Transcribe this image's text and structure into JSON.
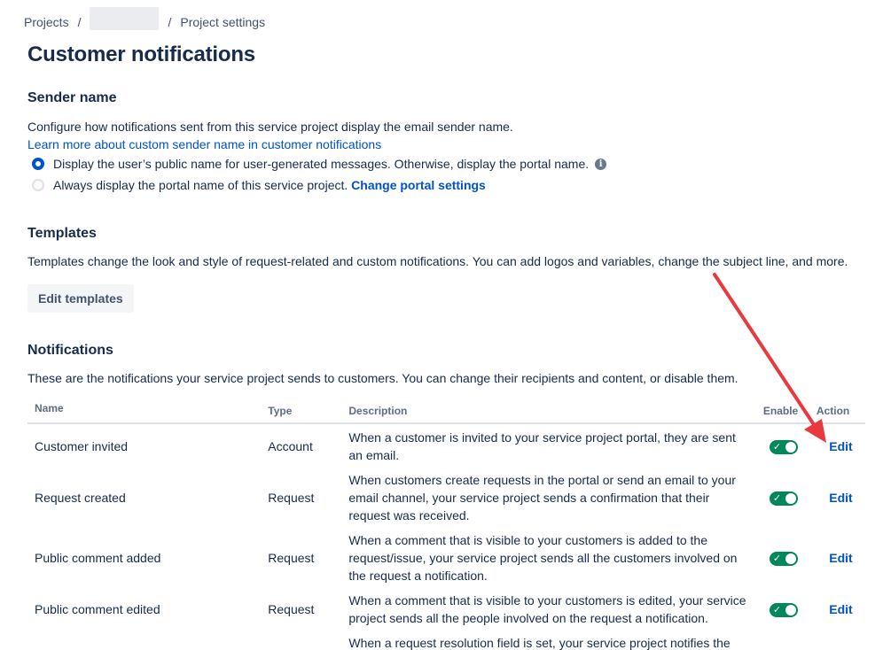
{
  "breadcrumb": {
    "projects": "Projects",
    "separator": "/",
    "project_settings": "Project settings"
  },
  "page_title": "Customer notifications",
  "sender_name": {
    "heading": "Sender name",
    "description": "Configure how notifications sent from this service project display the email sender name.",
    "learn_more": "Learn more about custom sender name in customer notifications",
    "options": [
      {
        "label": "Display the user’s public name for user-generated messages. Otherwise, display the portal name.",
        "checked": true,
        "info_icon": "info-icon"
      },
      {
        "label": "Always display the portal name of this service project.",
        "checked": false,
        "link": "Change portal settings"
      }
    ]
  },
  "templates": {
    "heading": "Templates",
    "description": "Templates change the look and style of request-related and custom notifications. You can add logos and variables, change the subject line, and more.",
    "button": "Edit templates"
  },
  "notifications": {
    "heading": "Notifications",
    "description": "These are the notifications your service project sends to customers. You can change their recipients and content, or disable them.",
    "columns": [
      "Name",
      "Type",
      "Description",
      "Enable",
      "Action"
    ],
    "rows": [
      {
        "name": "Customer invited",
        "type": "Account",
        "description": "When a customer is invited to your service project portal, they are sent an email.",
        "enabled": true,
        "action": "Edit"
      },
      {
        "name": "Request created",
        "type": "Request",
        "description": "When customers create requests in the portal or send an email to your email channel, your service project sends a confirmation that their request was received.",
        "enabled": true,
        "action": "Edit"
      },
      {
        "name": "Public comment added",
        "type": "Request",
        "description": "When a comment that is visible to your customers is added to the request/issue, your service project sends all the customers involved on the request a notification.",
        "enabled": true,
        "action": "Edit"
      },
      {
        "name": "Public comment edited",
        "type": "Request",
        "description": "When a comment that is visible to your customers is edited, your service project sends all the people involved on the request a notification.",
        "enabled": true,
        "action": "Edit"
      },
      {
        "name": "",
        "type": "",
        "description": "When a request resolution field is set, your service project notifies the",
        "enabled": null,
        "action": ""
      }
    ]
  },
  "colors": {
    "toggle_on": "#00875a",
    "link": "#0052cc",
    "annotation_arrow": "#e8393f"
  }
}
